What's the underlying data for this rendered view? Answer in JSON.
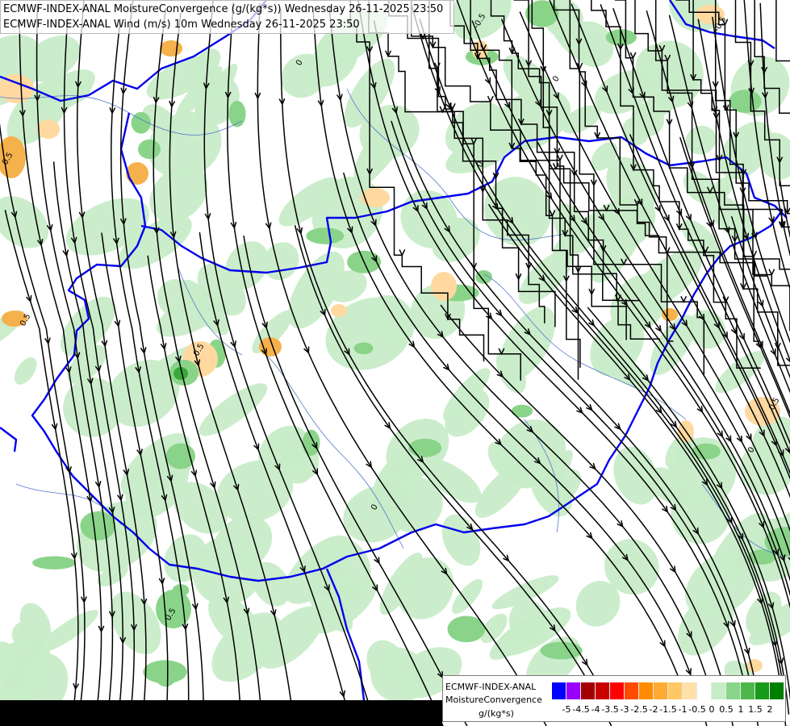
{
  "title": {
    "line1": "ECMWF-INDEX-ANAL MoistureConvergence (g/(kg*s)) Wednesday 26-11-2025 23:50",
    "line2": "ECMWF-INDEX-ANAL Wind (m/s) 10m Wednesday 26-11-2025 23:50"
  },
  "contour_labels": [
    "0",
    "-0.5",
    "0.5"
  ],
  "legend": {
    "title_line1": "ECMWF-INDEX-ANAL",
    "title_line2": "MoistureConvergence",
    "units": "g/(kg*s)",
    "ticks": [
      "-5",
      "-4.5",
      "-4",
      "-3.5",
      "-3",
      "-2.5",
      "-2",
      "-1.5",
      "-1",
      "-0.5",
      "0",
      "0.5",
      "1",
      "1.5",
      "2"
    ],
    "colors": [
      "#0000ff",
      "#9900ff",
      "#a50000",
      "#c80000",
      "#ff0000",
      "#ff4a00",
      "#ff8c00",
      "#ffaa33",
      "#ffc864",
      "#ffe0a8",
      "#ffffff",
      "#c8ecc8",
      "#8ad48a",
      "#4cb84c",
      "#1a9a1a",
      "#008000"
    ]
  },
  "colors": {
    "border": "#0000ee",
    "rivers": "#5577cc",
    "streamlines": "#000000",
    "green_light": "#c8ecc8",
    "green_mid": "#8ad48a",
    "green_dark": "#38a838",
    "orange_light": "#ffd9a0",
    "orange_mid": "#f5b14c"
  }
}
